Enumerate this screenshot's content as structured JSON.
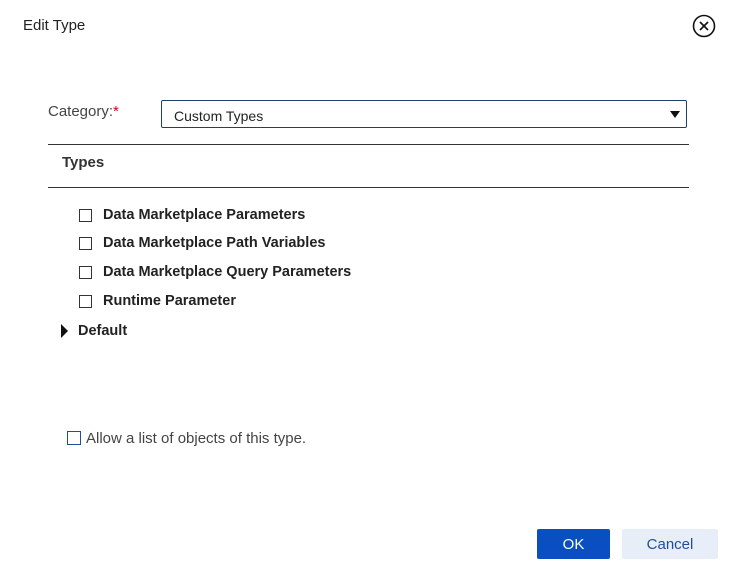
{
  "dialog": {
    "title": "Edit Type",
    "close_icon": "close-circle-icon"
  },
  "category": {
    "label": "Category:",
    "required_marker": "*",
    "selected_value": "Custom Types",
    "dropdown_icon": "caret-down-icon"
  },
  "types": {
    "header": "Types",
    "items": [
      {
        "label": "Data Marketplace Parameters",
        "checked": false
      },
      {
        "label": "Data Marketplace Path Variables",
        "checked": false
      },
      {
        "label": "Data Marketplace Query Parameters",
        "checked": false
      },
      {
        "label": "Runtime Parameter",
        "checked": false
      }
    ],
    "tree_node": {
      "label": "Default",
      "expanded": false,
      "icon": "caret-right-icon"
    }
  },
  "allow_list": {
    "label": "Allow a list of objects of this type.",
    "checked": false
  },
  "buttons": {
    "ok": "OK",
    "cancel": "Cancel"
  },
  "colors": {
    "accent": "#0a4fc2",
    "cancel_bg": "#e8eef7",
    "required": "#d0021b",
    "select_border": "#1f3e6e"
  }
}
